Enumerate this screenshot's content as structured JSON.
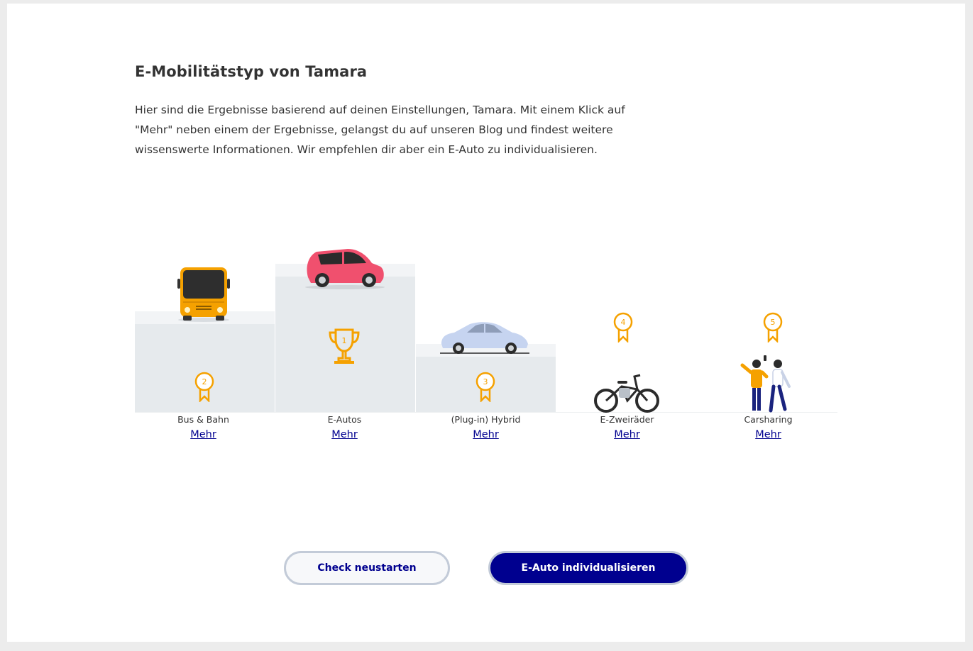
{
  "header": {
    "title": "E-Mobilitätstyp von Tamara",
    "description": "Hier sind die Ergebnisse basierend auf deinen Einstellungen, Tamara. Mit einem Klick auf \"Mehr\" neben einem der Ergebnisse, gelangst du auf unseren Blog und findest weitere wissenswerte Informationen. Wir empfehlen dir aber ein E-Auto zu individualisieren."
  },
  "ranking": [
    {
      "rank": "2",
      "label": "Bus & Bahn",
      "link": "Mehr",
      "icon": "bus-icon"
    },
    {
      "rank": "1",
      "label": "E-Autos",
      "link": "Mehr",
      "icon": "e-car-icon"
    },
    {
      "rank": "3",
      "label": "(Plug-in) Hybrid",
      "link": "Mehr",
      "icon": "hybrid-car-icon"
    },
    {
      "rank": "4",
      "label": "E-Zweiräder",
      "link": "Mehr",
      "icon": "e-bike-icon"
    },
    {
      "rank": "5",
      "label": "Carsharing",
      "link": "Mehr",
      "icon": "carsharing-people-icon"
    }
  ],
  "colors": {
    "accent": "#f5a100",
    "primary": "#00008f",
    "podium": "#e6eaed",
    "bus": "#f5a100",
    "e_car": "#f0506e",
    "hybrid_car": "#c6d4f0"
  },
  "buttons": {
    "restart": "Check neustarten",
    "configure": "E-Auto individualisieren"
  }
}
